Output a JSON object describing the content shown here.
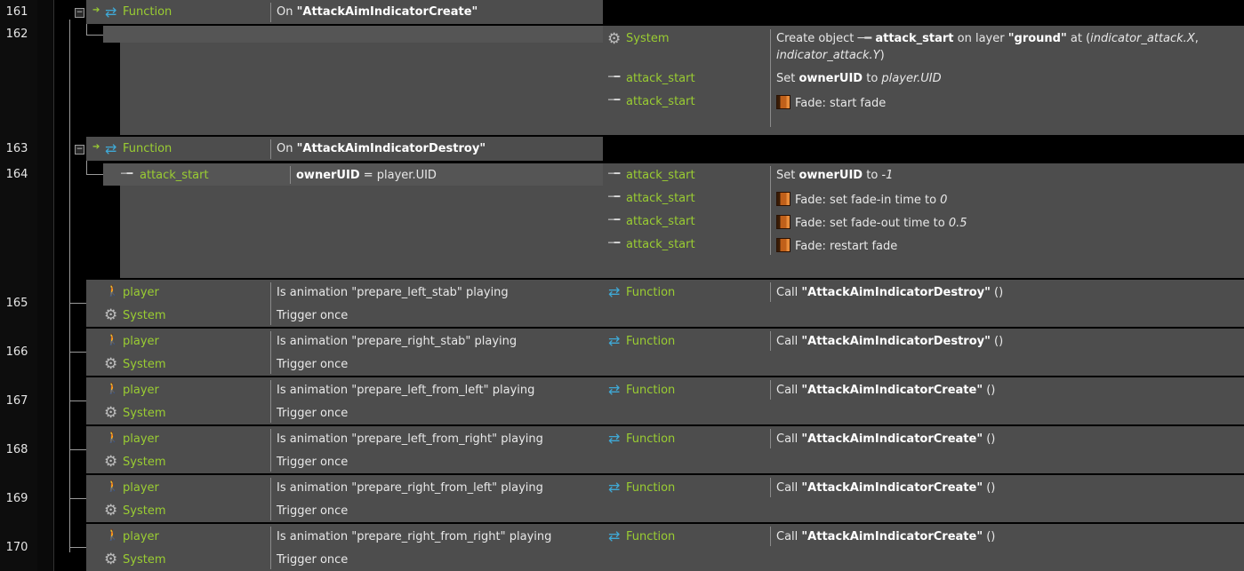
{
  "rows": {
    "r161": "161",
    "r162": "162",
    "r163": "163",
    "r164": "164",
    "r165": "165",
    "r166": "166",
    "r167": "167",
    "r168": "168",
    "r169": "169",
    "r170": "170"
  },
  "objects": {
    "function": "Function",
    "system": "System",
    "attack_start": "attack_start",
    "player": "player"
  },
  "functions": {
    "create_event": "On ",
    "create_name": "\"AttackAimIndicatorCreate\"",
    "destroy_event": "On ",
    "destroy_name": "\"AttackAimIndicatorDestroy\""
  },
  "e162": {
    "a1_pre": "Create object ",
    "a1_obj": "attack_start",
    "a1_mid": " on layer ",
    "a1_layer": "\"ground\"",
    "a1_at": " at (",
    "a1_x": "indicator_attack.X",
    "a1_comma": ",",
    "a1_y": "indicator_attack.Y",
    "a1_close": ")",
    "a2_pre": "Set ",
    "a2_var": "ownerUID",
    "a2_mid": " to ",
    "a2_val": "player.UID",
    "a3": "Fade: start fade"
  },
  "e164": {
    "cond_var": "ownerUID",
    "cond_rest": " = player.UID",
    "a1_pre": "Set ",
    "a1_var": "ownerUID",
    "a1_mid": " to ",
    "a1_val": "-1",
    "a2_pre": "Fade: set fade-in time to ",
    "a2_val": "0",
    "a3_pre": "Fade: set fade-out time to ",
    "a3_val": "0.5",
    "a4": "Fade: restart fade"
  },
  "trigger_events": [
    {
      "cond": "Is animation \"prepare_left_stab\" playing",
      "call": "\"AttackAimIndicatorDestroy\""
    },
    {
      "cond": "Is animation \"prepare_right_stab\" playing",
      "call": "\"AttackAimIndicatorDestroy\""
    },
    {
      "cond": "Is animation \"prepare_left_from_left\" playing",
      "call": "\"AttackAimIndicatorCreate\""
    },
    {
      "cond": "Is animation \"prepare_left_from_right\" playing",
      "call": "\"AttackAimIndicatorCreate\""
    },
    {
      "cond": "Is animation \"prepare_right_from_left\" playing",
      "call": "\"AttackAimIndicatorCreate\""
    },
    {
      "cond": "Is animation \"prepare_right_from_right\" playing",
      "call": "\"AttackAimIndicatorCreate\""
    }
  ],
  "common": {
    "trigger_once": "Trigger once",
    "call_pre": "Call ",
    "call_post": " ()"
  },
  "icons": {
    "function": "function-icon",
    "system": "system-gear-icon",
    "sprite": "attack-start-sprite-icon",
    "player": "player-sprite-icon",
    "fade": "fade-behavior-icon",
    "trigger": "function-trigger-icon"
  },
  "colors": {
    "object_name": "#9acd32",
    "event_bg": "#4d4d4d",
    "sub_bg": "#555555",
    "background": "#000000"
  }
}
